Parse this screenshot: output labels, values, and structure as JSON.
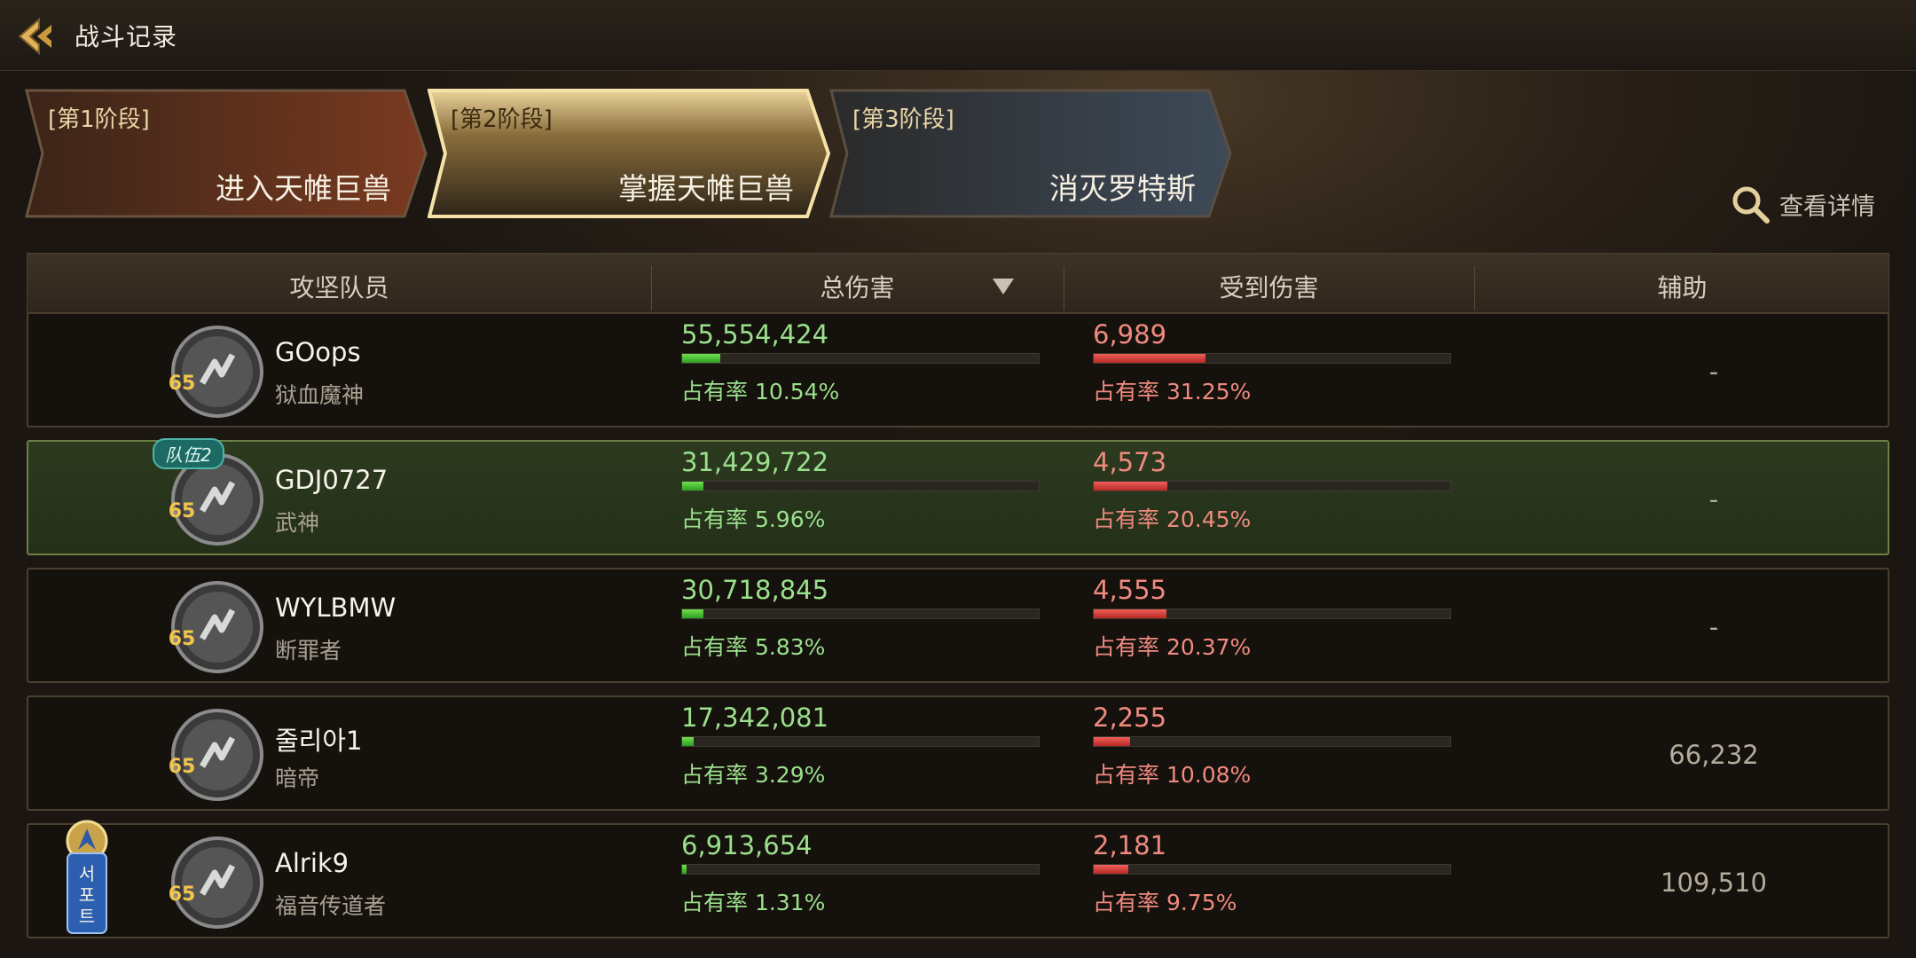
{
  "header": {
    "title": "战斗记录"
  },
  "stages": [
    {
      "tag": "[第1阶段]",
      "name": "进入天帷巨兽",
      "active": false
    },
    {
      "tag": "[第2阶段]",
      "name": "掌握天帷巨兽",
      "active": true
    },
    {
      "tag": "[第3阶段]",
      "name": "消灭罗特斯",
      "active": false
    }
  ],
  "detail_label": "查看详情",
  "columns": {
    "member": "攻坚队员",
    "damage": "总伤害",
    "taken": "受到伤害",
    "assist": "辅助"
  },
  "rows": [
    {
      "name": "GOops",
      "class": "狱血魔神",
      "level": "65",
      "damage": "55,554,424",
      "damage_share": "占有率 10.54%",
      "damage_frac": 0.1054,
      "taken": "6,989",
      "taken_share": "占有率 31.25%",
      "taken_frac": 0.3125,
      "assist": "-"
    },
    {
      "name": "GDJ0727",
      "class": "武神",
      "level": "65",
      "party": "队伍2",
      "damage": "31,429,722",
      "damage_share": "占有率 5.96%",
      "damage_frac": 0.0596,
      "taken": "4,573",
      "taken_share": "占有率 20.45%",
      "taken_frac": 0.2045,
      "assist": "-"
    },
    {
      "name": "WYLBMW",
      "class": "断罪者",
      "level": "65",
      "damage": "30,718,845",
      "damage_share": "占有率 5.83%",
      "damage_frac": 0.0583,
      "taken": "4,555",
      "taken_share": "占有率 20.37%",
      "taken_frac": 0.2037,
      "assist": "-"
    },
    {
      "name": "줄리아1",
      "class": "暗帝",
      "level": "65",
      "damage": "17,342,081",
      "damage_share": "占有率 3.29%",
      "damage_frac": 0.0329,
      "taken": "2,255",
      "taken_share": "占有率 10.08%",
      "taken_frac": 0.1008,
      "assist": "66,232"
    },
    {
      "name": "Alrik9",
      "class": "福音传道者",
      "level": "65",
      "badge_text": "서포트",
      "damage": "6,913,654",
      "damage_share": "占有率 1.31%",
      "damage_frac": 0.0131,
      "taken": "2,181",
      "taken_share": "占有率 9.75%",
      "taken_frac": 0.0975,
      "assist": "109,510"
    }
  ],
  "colors": {
    "damage": "#9be08c",
    "taken": "#f08a7f",
    "active_tab": "#e7cd86",
    "highlight_row": "#2c3a1f"
  }
}
